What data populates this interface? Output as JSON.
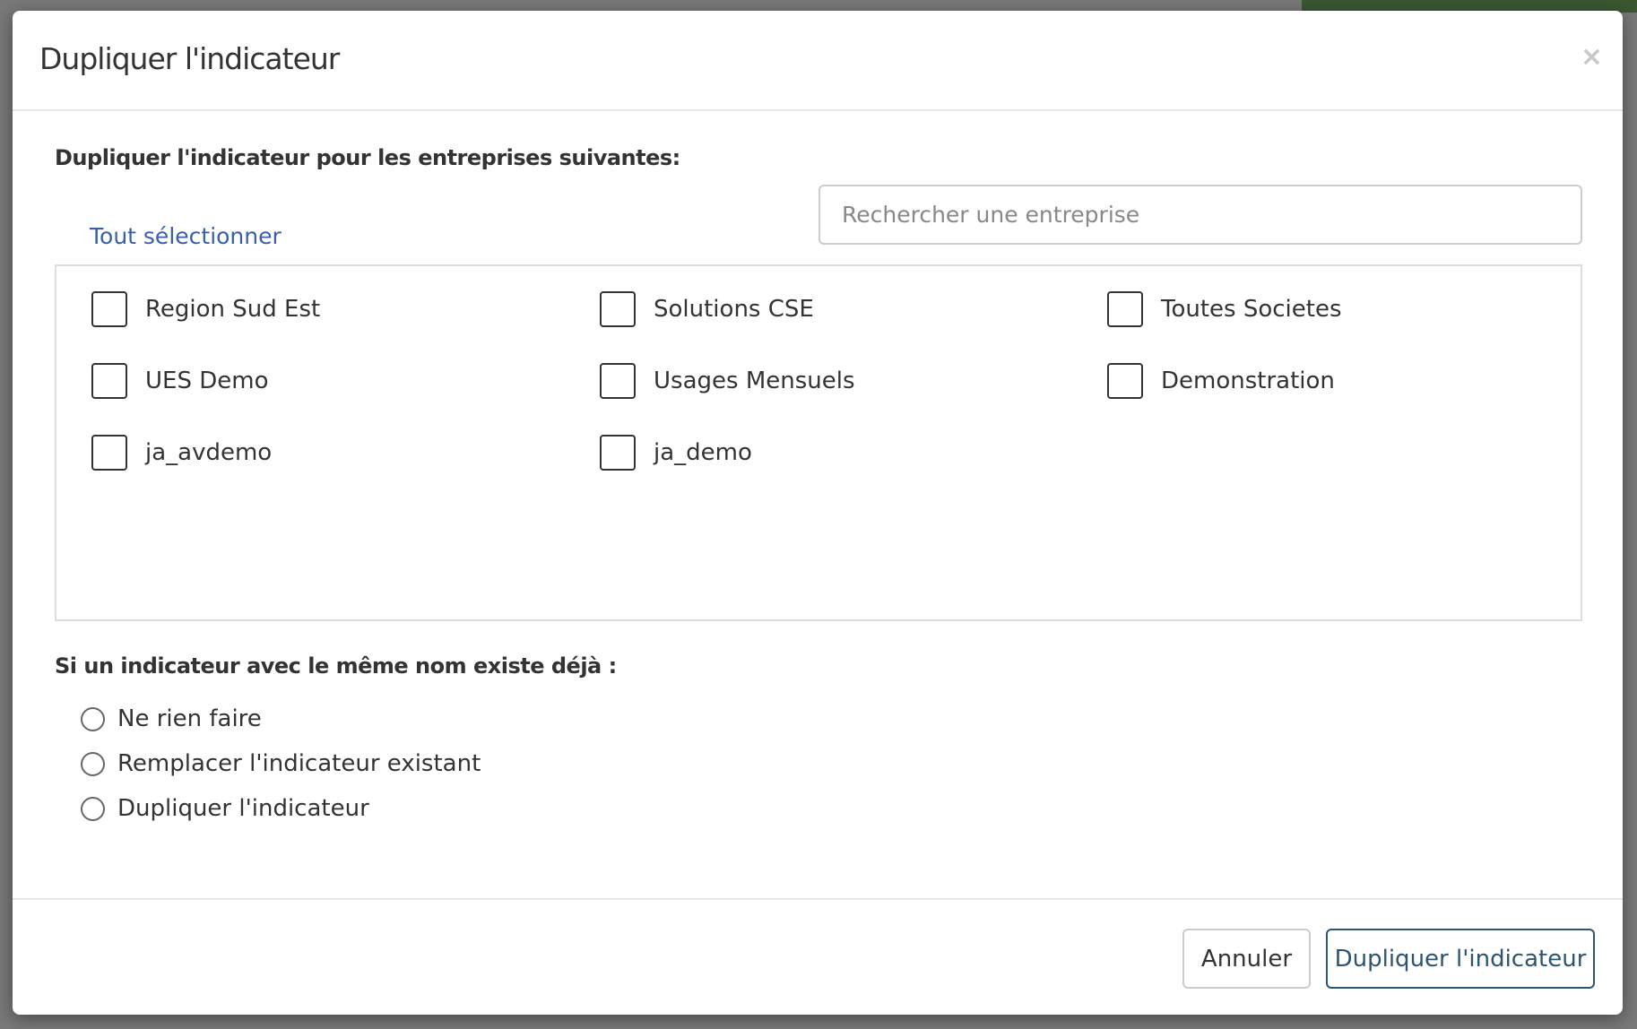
{
  "modal": {
    "title": "Dupliquer l'indicateur",
    "close_icon": "×",
    "companies_heading": "Dupliquer l'indicateur pour les entreprises suivantes:",
    "select_all": "Tout sélectionner",
    "search_placeholder": "Rechercher une entreprise",
    "search_value": "",
    "companies": [
      {
        "label": "Region Sud Est",
        "checked": false
      },
      {
        "label": "Solutions CSE",
        "checked": false
      },
      {
        "label": "Toutes Societes",
        "checked": false
      },
      {
        "label": "UES Demo",
        "checked": false
      },
      {
        "label": "Usages Mensuels",
        "checked": false
      },
      {
        "label": "Demonstration",
        "checked": false
      },
      {
        "label": "ja_avdemo",
        "checked": false
      },
      {
        "label": "ja_demo",
        "checked": false
      }
    ],
    "conflict_heading": "Si un indicateur avec le même nom existe déjà :",
    "options": [
      {
        "label": "Ne rien faire",
        "selected": false
      },
      {
        "label": "Remplacer l'indicateur existant",
        "selected": false
      },
      {
        "label": "Dupliquer l'indicateur",
        "selected": false
      }
    ],
    "cancel_label": "Annuler",
    "submit_label": "Dupliquer l'indicateur"
  },
  "colors": {
    "accent": "#2e5570",
    "link": "#3a5fa8"
  }
}
